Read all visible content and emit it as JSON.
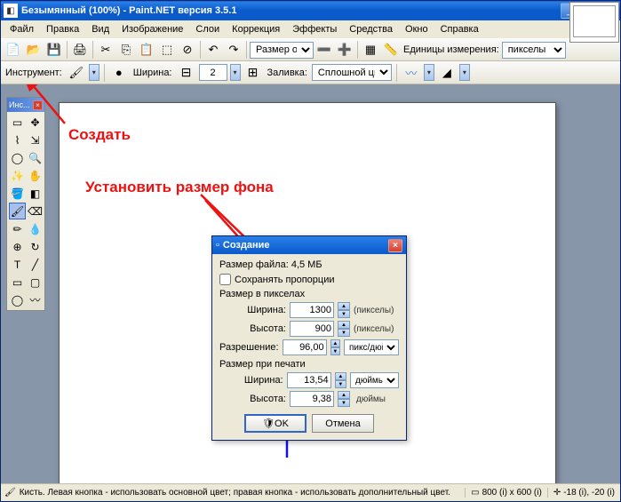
{
  "title": "Безымянный (100%) - Paint.NET версия 3.5.1",
  "menu": [
    "Файл",
    "Правка",
    "Вид",
    "Изображение",
    "Слои",
    "Коррекция",
    "Эффекты",
    "Средства",
    "Окно",
    "Справка"
  ],
  "toolbar": {
    "zoom_label": "Размер окн",
    "units_label": "Единицы измерения:",
    "units_value": "пикселы"
  },
  "toolbar2": {
    "tool_label": "Инструмент:",
    "width_label": "Ширина:",
    "width_value": "2",
    "fill_label": "Заливка:",
    "fill_value": "Сплошной цвет"
  },
  "toolbox_title": "Инс...",
  "status": {
    "hint": "Кисть. Левая кнопка - использовать основной цвет; правая кнопка - использовать дополнительный цвет.",
    "dims": "800 (i) x 600 (i)",
    "pos": "-18 (i), -20 (i)"
  },
  "annotations": {
    "create": "Создать",
    "setbg": "Установить размер фона"
  },
  "dialog": {
    "title": "Создание",
    "filesize": "Размер файла: 4,5 МБ",
    "keep_prop": "Сохранять пропорции",
    "pixels_group": "Размер в пикселах",
    "width_l": "Ширина:",
    "width_v": "1300",
    "width_u": "(пикселы)",
    "height_l": "Высота:",
    "height_v": "900",
    "height_u": "(пикселы)",
    "res_l": "Разрешение:",
    "res_v": "96,00",
    "res_u": "пикс/дюйм",
    "print_group": "Размер при печати",
    "pwidth_l": "Ширина:",
    "pwidth_v": "13,54",
    "pwidth_u": "дюймы",
    "pheight_l": "Высота:",
    "pheight_v": "9,38",
    "pheight_u": "дюймы",
    "ok": "OK",
    "cancel": "Отмена"
  }
}
